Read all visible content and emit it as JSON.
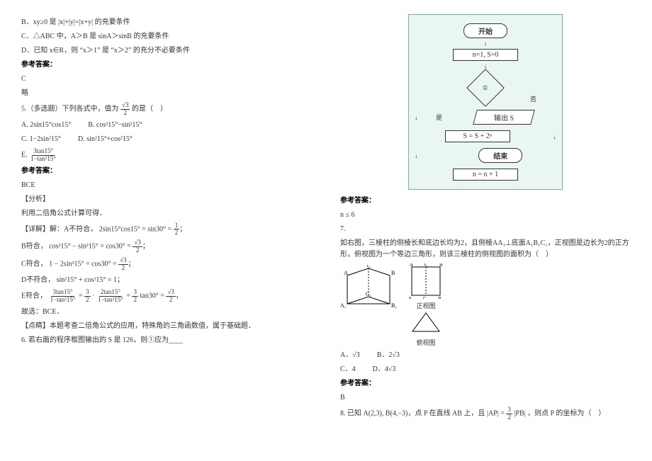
{
  "left": {
    "optB": "B．xy≥0 是 |x|+|y|=|x+y| 的充要条件",
    "optC_pre": "C．△ABC 中，A＞B 是 sinA＞sinB 的充要条件",
    "optD": "D．已知 x∈R，则 “x＞1” 是 “x＞2” 的充分不必要条件",
    "ans_lbl": "参考答案：",
    "ans_val": "C",
    "skip": "略",
    "q5_pre": "5.（多选题）下列各式中，值为",
    "q5_frac_num": "√3",
    "q5_frac_den": "2",
    "q5_post": " 的是（　）",
    "q5_A": "A. 2sin15°cos15°",
    "q5_B": "B. cos²15°−sin²15°",
    "q5_C": "C. 1−2sin²15°",
    "q5_D": "D. sin²15°+cos²15°",
    "q5_E_pre": "E. ",
    "q5_E_num": "3tan15°",
    "q5_E_den": "1−tan²15°",
    "ans5_lbl": "参考答案：",
    "ans5_val": "BCE",
    "ana_lbl": "【分析】",
    "ana_txt": "利用二倍角公式计算可得．",
    "det_lbl": "【详解】解：A不符合，",
    "det_A_lhs": "2sin15°cos15° = sin30° = ",
    "det_A_num": "1",
    "det_A_den": "2",
    "det_B_pre": "B符合，",
    "det_B_lhs": "cos²15° − sin²15° = cos30° = ",
    "det_B_num": "√3",
    "det_B_den": "2",
    "det_C_pre": "C符合，",
    "det_C_lhs": "1 − 2sin²15° = cos30° = ",
    "det_C_num": "√3",
    "det_C_den": "2",
    "det_D_pre": "D不符合，",
    "det_D_lhs": "sin²15° + cos²15° = 1",
    "det_E_pre": "E符合，",
    "det_E_p1n": "3tan15°",
    "det_E_p1d": "1−tan²15°",
    "det_E_mid1": " = ",
    "det_E_p2n1": "3",
    "det_E_p2d1": "2",
    "det_E_mid2": "·",
    "det_E_p3n": "2tan15°",
    "det_E_p3d": "1−tan²15°",
    "det_E_mid3": " = ",
    "det_E_p4n": "3",
    "det_E_p4d": "2",
    "det_E_mid4": " tan30° = ",
    "det_E_p5n": "√3",
    "det_E_p5d": "2",
    "concl": "故选：BCE．",
    "point": "【点睛】本题考查二倍角公式的应用，特殊角的三角函数值，属于基础题．",
    "q6": "6. 若右面的程序框图输出的 S 是 126，则①应为____"
  },
  "right": {
    "fc_start": "开始",
    "fc_init": "n=1, S=0",
    "fc_cond": "①",
    "fc_no": "否",
    "fc_yes": "是",
    "fc_out_lbl": "输出 S",
    "fc_step": "S = S + 2ⁿ",
    "fc_inc": "n = n + 1",
    "fc_end": "结束",
    "ans6_lbl": "参考答案：",
    "ans6_val": "n ≤ 6",
    "q7_pre": "7.",
    "q7_body": "如右图，三棱柱的侧棱长和底边长均为2，且侧棱AA₁⊥底面A₁B₁C₁，正视图是边长为2的正方形，俯视图为一个等边三角形，则该三棱柱的侧视图的面积为（　）",
    "fig_main_lbl": "正视图",
    "fig_side_lbl": "俯视图",
    "fig_A": "A",
    "fig_B": "B",
    "fig_C": "C",
    "fig_A1": "A₁",
    "fig_B1": "B₁",
    "fig_C1": "C₁",
    "q7_A": "A．√3",
    "q7_B": "B．2√3",
    "q7_C": "C．4",
    "q7_D": "D．4√3",
    "ans7_lbl": "参考答案：",
    "ans7_val": "B",
    "q8_pre": "8. 已知 A(2,3), B(4,−3)，点 P 在直线 AB 上，且 ",
    "q8_ap": "|AP| = ",
    "q8_num": "3",
    "q8_den": "2",
    "q8_pb": "|PB|",
    "q8_post": "，则点 P 的坐标为（　）"
  }
}
